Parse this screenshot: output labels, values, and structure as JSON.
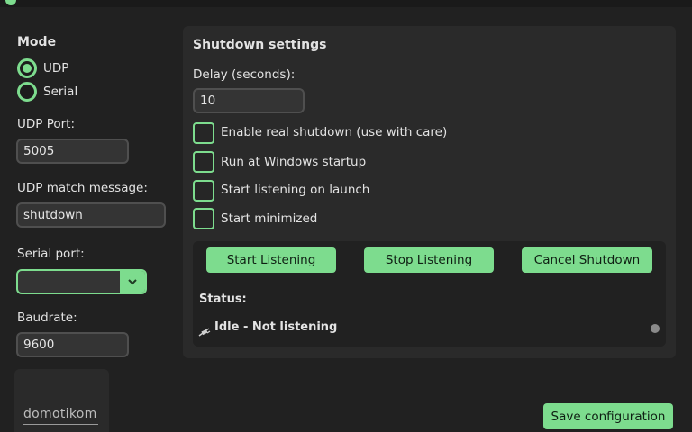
{
  "mode": {
    "heading": "Mode",
    "options": [
      {
        "label": "UDP",
        "selected": true
      },
      {
        "label": "Serial",
        "selected": false
      }
    ]
  },
  "udp": {
    "port_label": "UDP Port:",
    "port_value": "5005",
    "match_label": "UDP match message:",
    "match_value": "shutdown"
  },
  "serial": {
    "port_label": "Serial port:",
    "port_value": "",
    "baud_label": "Baudrate:",
    "baud_value": "9600"
  },
  "logo": {
    "text": "domotikom"
  },
  "shutdown": {
    "heading": "Shutdown settings",
    "delay_label": "Delay (seconds):",
    "delay_value": "10",
    "checkboxes": [
      {
        "label": "Enable real shutdown (use with care)",
        "checked": false
      },
      {
        "label": "Run at Windows startup",
        "checked": false
      },
      {
        "label": "Start listening on launch",
        "checked": false
      },
      {
        "label": "Start minimized",
        "checked": false
      }
    ]
  },
  "actions": {
    "start": "Start Listening",
    "stop": "Stop Listening",
    "cancel": "Cancel Shutdown"
  },
  "status": {
    "label": "Status:",
    "text": "Idle - Not listening",
    "icon": "plug-icon",
    "indicator_color": "#8a8a8a"
  },
  "save_label": "Save configuration",
  "colors": {
    "accent": "#7ddc8e",
    "background": "#212121",
    "panel": "#2a2a2a"
  }
}
